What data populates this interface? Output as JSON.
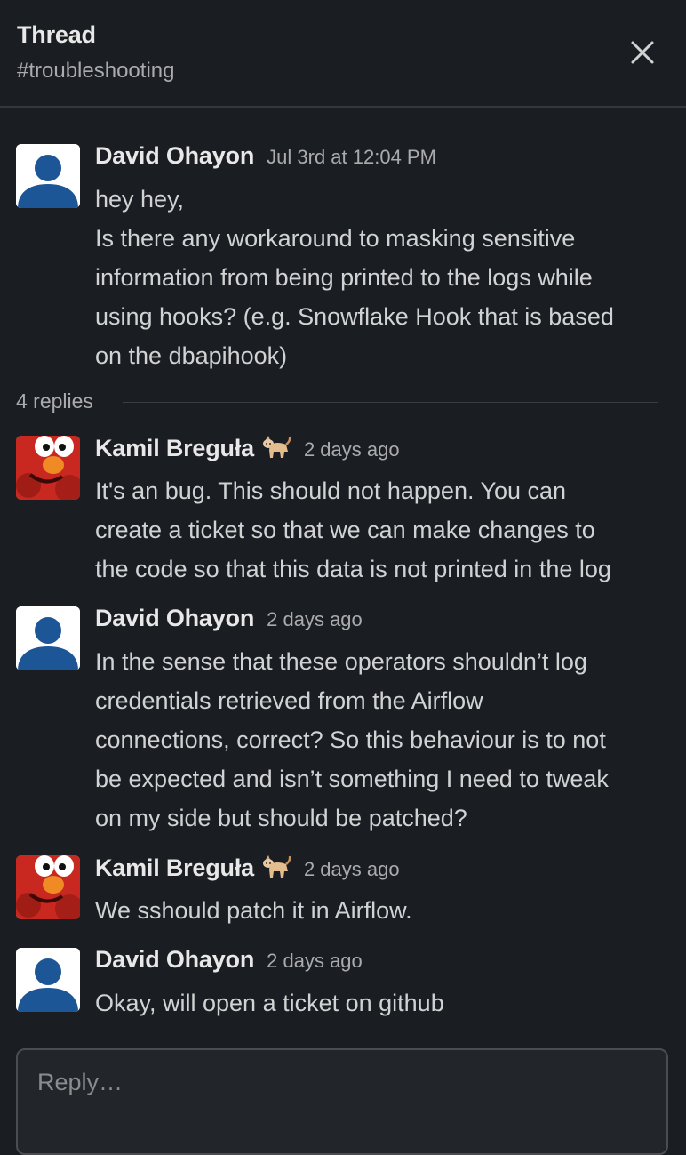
{
  "header": {
    "title": "Thread",
    "channel": "#troubleshooting"
  },
  "replies_label": "4 replies",
  "messages": [
    {
      "author": "David Ohayon",
      "timestamp": "Jul 3rd at 12:04 PM",
      "avatar": "default-user-avatar",
      "lines": [
        "hey hey,",
        "Is there any workaround to masking sensitive",
        "information from being printed to the logs while",
        "using hooks? (e.g. Snowflake Hook that is based",
        "on the dbapihook)"
      ]
    },
    {
      "author": "Kamil Breguła",
      "status_emoji": "cat-emoji",
      "timestamp": "2 days ago",
      "avatar": "elmo-avatar",
      "lines": [
        "It's an bug. This should not happen. You can",
        "create a ticket so that we can make changes to",
        "the code so that this data is not printed in the log"
      ]
    },
    {
      "author": "David Ohayon",
      "timestamp": "2 days ago",
      "avatar": "default-user-avatar",
      "lines": [
        "In the sense that these operators shouldn’t log",
        "credentials retrieved from the Airflow",
        "connections, correct? So this behaviour is to not",
        "be expected and isn’t something I need to tweak",
        "on my side but should be patched?"
      ]
    },
    {
      "author": "Kamil Breguła",
      "status_emoji": "cat-emoji",
      "timestamp": "2 days ago",
      "avatar": "elmo-avatar",
      "lines": [
        "We sshould patch it in Airflow."
      ]
    },
    {
      "author": "David Ohayon",
      "timestamp": "2 days ago",
      "avatar": "default-user-avatar",
      "lines": [
        "Okay, will open a ticket on github"
      ]
    }
  ],
  "composer": {
    "placeholder": "Reply…"
  },
  "colors": {
    "background": "#1a1d21",
    "default_avatar_fg": "#1d5696",
    "default_avatar_bg": "#ffffff"
  }
}
